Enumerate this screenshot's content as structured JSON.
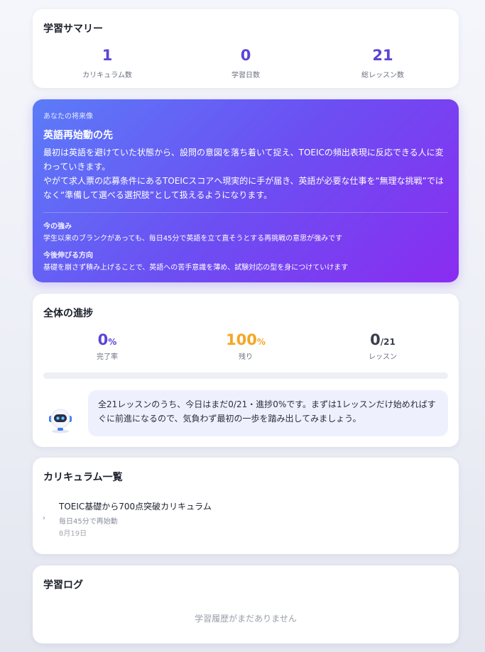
{
  "summary": {
    "title": "学習サマリー",
    "stats": [
      {
        "value": "1",
        "label": "カリキュラム数"
      },
      {
        "value": "0",
        "label": "学習日数"
      },
      {
        "value": "21",
        "label": "総レッスン数"
      }
    ]
  },
  "future": {
    "eyebrow": "あなたの将来像",
    "heading": "英語再始動の先",
    "paragraph_1": "最初は英語を避けていた状態から、設問の意図を落ち着いて捉え、TOEICの頻出表現に反応できる人に変わっていきます。",
    "paragraph_2": "やがて求人票の応募条件にあるTOEICスコアへ現実的に手が届き、英語が必要な仕事を“無理な挑戦”ではなく“準備して選べる選択肢”として扱えるようになります。",
    "strength_heading": "今の強み",
    "strength_text": "学生以来のブランクがあっても、毎日45分で英語を立て直そうとする再挑戦の意思が強みです",
    "growth_heading": "今後伸びる方向",
    "growth_text": "基礎を崩さず積み上げることで、英語への苦手意識を薄め、試験対応の型を身につけていけます"
  },
  "progress": {
    "title": "全体の進捗",
    "complete_value": "0",
    "complete_unit": "%",
    "complete_label": "完了率",
    "remaining_value": "100",
    "remaining_unit": "%",
    "remaining_label": "残り",
    "lessons_value": "0",
    "lessons_total": "/21",
    "lessons_label": "レッスン",
    "fraction_complete": 0,
    "message": "全21レッスンのうち、今日はまだ0/21・進捗0%です。まずは1レッスンだけ始めればすぐに前進になるので、気負わず最初の一歩を踏み出してみましょう。"
  },
  "curriculum": {
    "title": "カリキュラム一覧",
    "items": [
      {
        "title": "TOEIC基礎から700点突破カリキュラム",
        "subtitle": "毎日45分で再始動",
        "date": "8月19日"
      }
    ]
  },
  "log": {
    "title": "学習ログ",
    "empty_text": "学習履歴がまだありません"
  },
  "colors": {
    "accent": "#5b45d6",
    "orange": "#f5a623",
    "gradient_start": "#5b7cf8",
    "gradient_end": "#8a2cf0"
  },
  "icons": {
    "mascot": "robot-mascot-icon",
    "chevron": "chevron-right-icon"
  }
}
